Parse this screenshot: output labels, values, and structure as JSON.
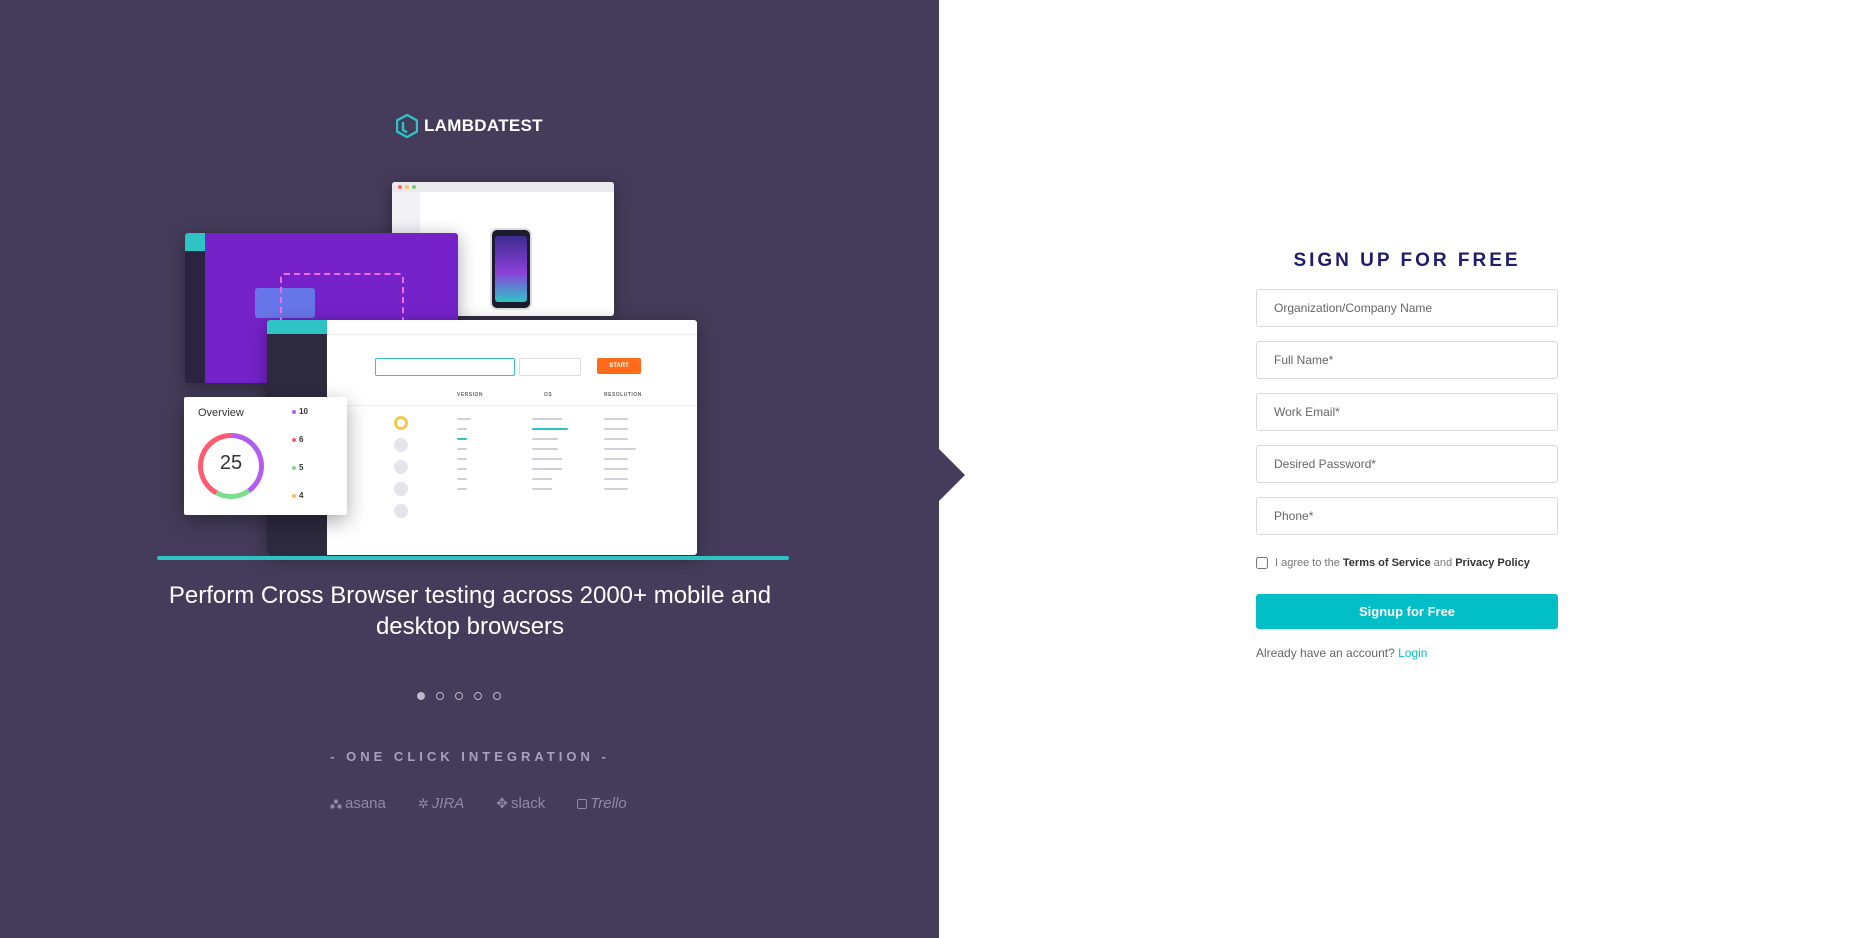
{
  "brand": {
    "name": "LAMBDATEST"
  },
  "promo": {
    "tagline": "Perform Cross Browser testing across 2000+ mobile and desktop browsers",
    "carousel_active": 1,
    "carousel_count": 5,
    "integration_heading": "- ONE CLICK INTEGRATION -",
    "integrations": [
      "asana",
      "JIRA",
      "slack",
      "Trello"
    ]
  },
  "illustration": {
    "overview_title": "Overview",
    "total_tests": "25",
    "stats": [
      {
        "value": "10",
        "color": "#b35cf2"
      },
      {
        "value": "6",
        "color": "#ff5a6e"
      },
      {
        "value": "5",
        "color": "#7be08c"
      },
      {
        "value": "4",
        "color": "#ffb84a"
      }
    ],
    "start_label": "START",
    "columns": [
      "VERSION",
      "OS",
      "RESOLUTION"
    ]
  },
  "form": {
    "title": "SIGN UP FOR FREE",
    "fields": {
      "org": "Organization/Company Name",
      "name": "Full Name*",
      "email": "Work Email*",
      "password": "Desired Password*",
      "phone": "Phone*"
    },
    "agree_prefix": "I agree to the",
    "terms": "Terms of Service",
    "and": "and",
    "privacy": "Privacy Policy",
    "submit": "Signup for Free",
    "have_account": "Already have an account?",
    "login": "Login"
  },
  "colors": {
    "left_panel_bg": "#443c5a",
    "accent": "#02bec6",
    "title": "#1f1b6d"
  }
}
